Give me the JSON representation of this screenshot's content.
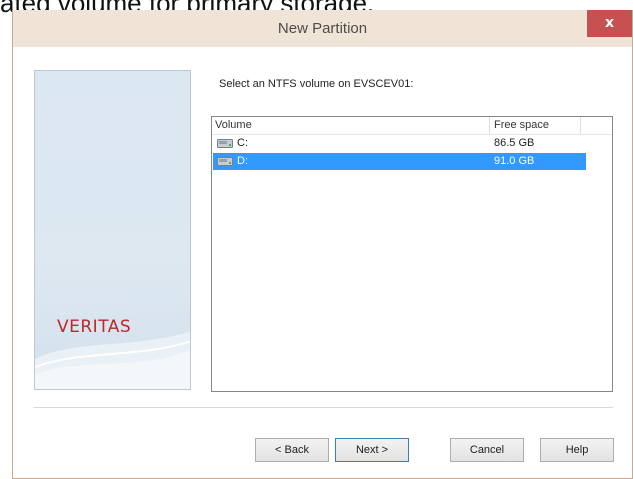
{
  "document_caption": "ated volume for primary storage.",
  "dialog": {
    "title": "New Partition",
    "close_label": "x"
  },
  "side_panel": {
    "logo_text": "VERITAS"
  },
  "prompt": "Select an NTFS volume on EVSCEV01:",
  "volume_list": {
    "columns": [
      "Volume",
      "Free space"
    ],
    "rows": [
      {
        "icon": "drive-icon",
        "volume": "C:",
        "free_space": "86.5 GB",
        "selected": false
      },
      {
        "icon": "drive-icon",
        "volume": "D:",
        "free_space": "91.0 GB",
        "selected": true
      }
    ]
  },
  "buttons": {
    "back": "< Back",
    "next": "Next >",
    "cancel": "Cancel",
    "help": "Help"
  },
  "colors": {
    "selection": "#3399ff",
    "logo": "#c0272d",
    "close_button": "#c75050"
  }
}
